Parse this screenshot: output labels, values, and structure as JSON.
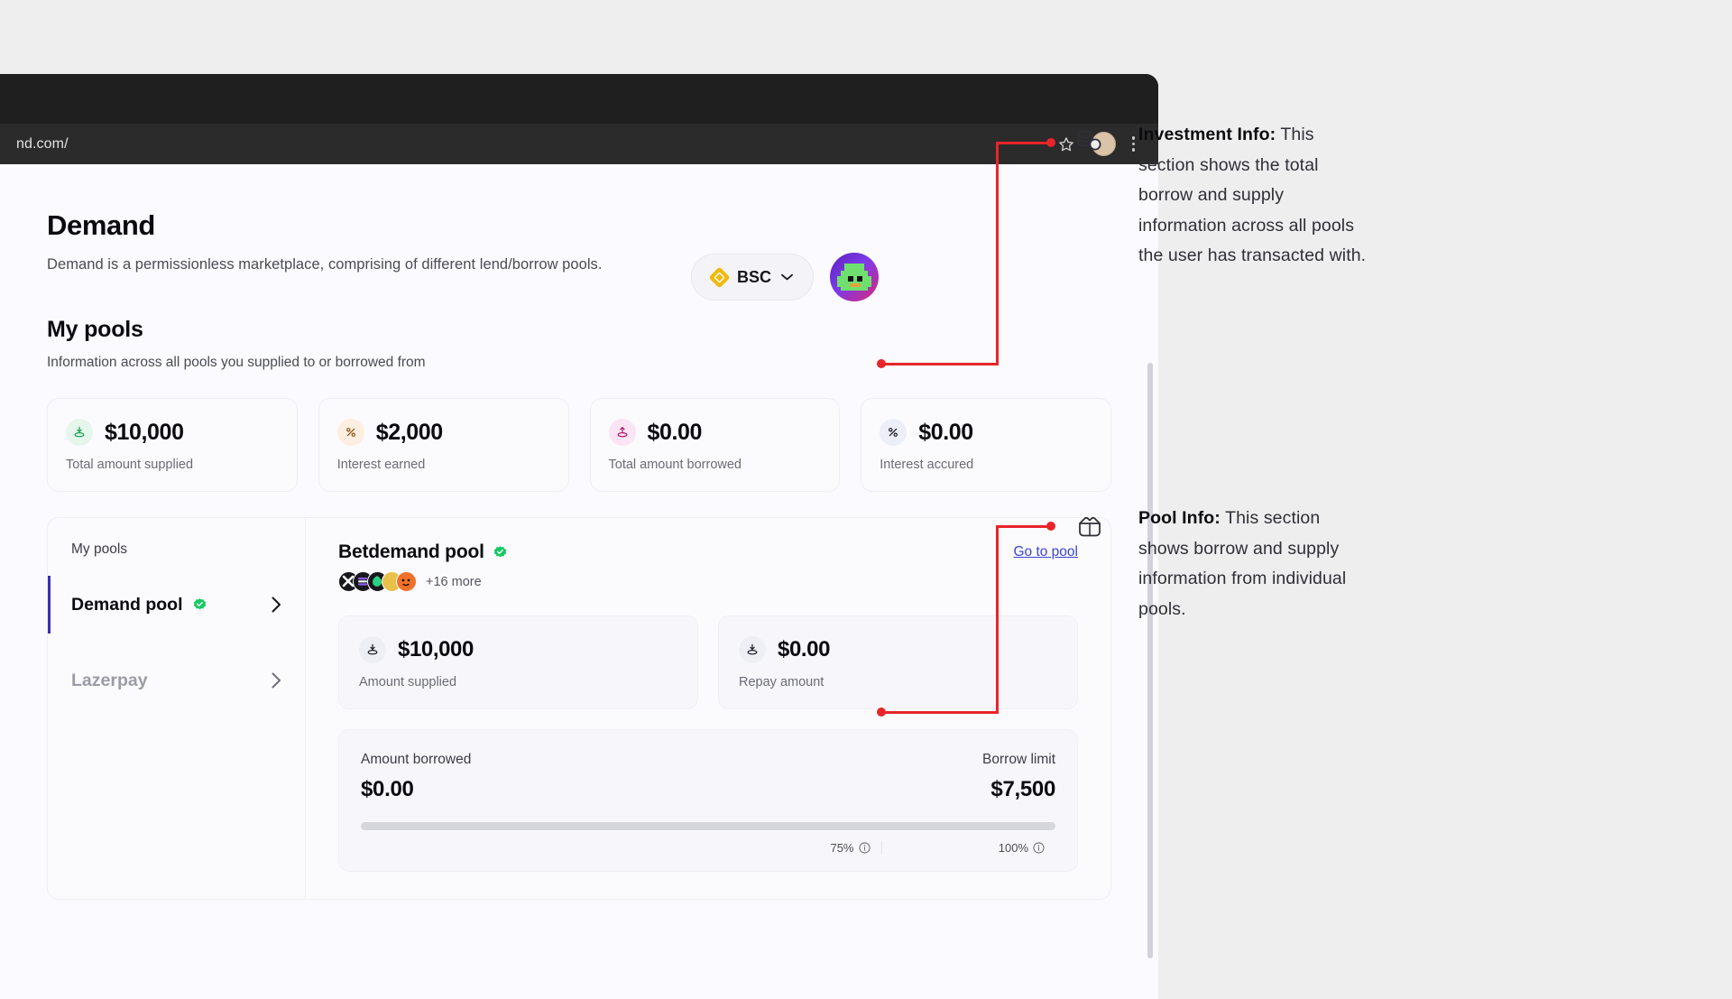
{
  "browser": {
    "url": "nd.com/",
    "star_icon": "star-icon",
    "profile_icon": "profile-avatar-icon",
    "menu_icon": "kebab-menu-icon"
  },
  "header": {
    "title": "Demand",
    "subtitle": "Demand is a permissionless marketplace, comprising of different lend/borrow pools.",
    "chain_chip": {
      "label": "BSC",
      "icon": "bnb-diamond-icon",
      "chevron": "chevron-down-icon"
    },
    "wallet_avatar": "wallet-avatar"
  },
  "my_pools_section": {
    "title": "My pools",
    "subtitle": "Information across all pools you supplied to or borrowed from",
    "stats": [
      {
        "value": "$10,000",
        "label": "Total amount supplied",
        "icon": "supply-icon",
        "icon_bg": "#e6f6ec",
        "icon_color": "#12a150"
      },
      {
        "value": "$2,000",
        "label": "Interest earned",
        "icon": "percent-icon",
        "icon_bg": "#fdeee0",
        "icon_color": "#b46a1a"
      },
      {
        "value": "$0.00",
        "label": "Total amount borrowed",
        "icon": "borrow-icon",
        "icon_bg": "#fbe4f3",
        "icon_color": "#c21a7a"
      },
      {
        "value": "$0.00",
        "label": "Interest accured",
        "icon": "percent-icon",
        "icon_bg": "#eceef8",
        "icon_color": "#1b1b24"
      }
    ]
  },
  "pools_panel": {
    "list_title": "My pools",
    "items": [
      {
        "name": "Demand pool",
        "verified": true,
        "active": true,
        "chevron": "chevron-right-icon"
      },
      {
        "name": "Lazerpay",
        "verified": false,
        "active": false,
        "chevron": "chevron-right-icon"
      }
    ],
    "detail": {
      "title": "Betdemand pool",
      "verified": true,
      "tokens_more": "+16 more",
      "token_colors": [
        "#1c1c22",
        "#1c1c22",
        "#1c1c22",
        "#e9c14a",
        "#f0722a"
      ],
      "goto_label": "Go to pool",
      "stats": [
        {
          "value": "$10,000",
          "label": "Amount supplied",
          "icon": "supply-icon"
        },
        {
          "value": "$0.00",
          "label": "Repay amount",
          "icon": "supply-icon"
        }
      ],
      "borrow": {
        "left_label": "Amount borrowed",
        "left_value": "$0.00",
        "right_label": "Borrow limit",
        "right_value": "$7,500",
        "progress_percent": 0,
        "tick_75": "75%",
        "tick_100": "100%",
        "tick_icon": "info-icon"
      }
    }
  },
  "annotations": [
    {
      "icon": "coins-stack-icon",
      "bold": "Investment Info:",
      "text": " This section shows the total borrow and supply information across all pools the user has transacted with."
    },
    {
      "icon": "pool-bag-icon",
      "bold": "Pool Info:",
      "text": " This section shows borrow and supply information from individual pools."
    }
  ],
  "colors": {
    "accent": "#3b44d4",
    "callout": "#e8252a",
    "verified": "#17c964"
  }
}
